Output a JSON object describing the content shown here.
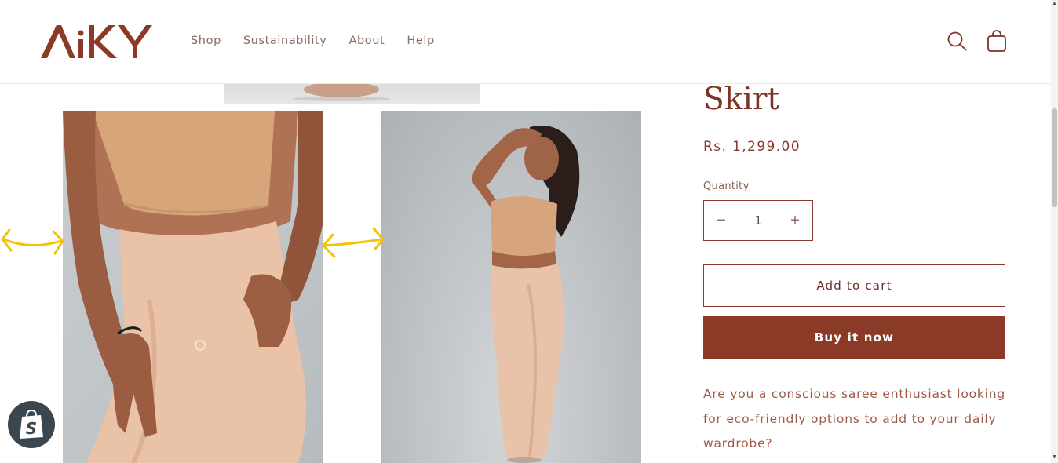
{
  "header": {
    "logo_text": "AiKY",
    "nav": [
      "Shop",
      "Sustainability",
      "About",
      "Help"
    ],
    "icons": [
      "search-icon",
      "cart-icon"
    ]
  },
  "product": {
    "title": "Skirt",
    "price": "Rs. 1,299.00",
    "quantity_label": "Quantity",
    "quantity_value": "1",
    "decrease_symbol": "−",
    "increase_symbol": "+",
    "add_to_cart_label": "Add to cart",
    "buy_now_label": "Buy it now",
    "description": "Are you a conscious saree enthusiast looking for eco-friendly options to add to your daily wardrobe?"
  },
  "gallery": {
    "images": [
      "model-closeup-photo",
      "model-full-length-photo"
    ],
    "annotation_arrows": [
      "double-arrow-icon",
      "double-arrow-icon"
    ]
  },
  "colors": {
    "brand": "#8b3a28",
    "text": "#8a3a2a",
    "arrow": "#f5c400",
    "badge": "#3b4750"
  },
  "badge": {
    "icon": "shopify-bag-icon"
  }
}
